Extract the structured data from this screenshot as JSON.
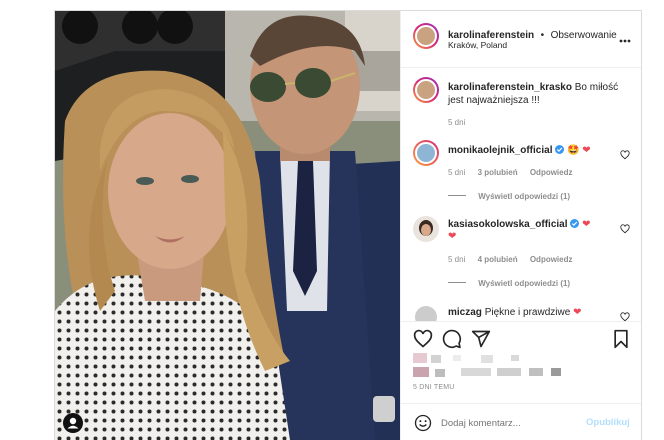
{
  "header": {
    "username": "karolinaferenstein",
    "dot": "•",
    "follow": "Obserwowanie",
    "location": "Kraków, Poland"
  },
  "caption": {
    "username": "karolinaferenstein_krasko",
    "text": "Bo miłość jest najważniejsza !!!",
    "time": "5 dni"
  },
  "comments": [
    {
      "username": "monikaolejnik_official",
      "emoji": "🤩",
      "time": "5 dni",
      "likes": "3 polubień",
      "reply": "Odpowiedz",
      "view_replies": "Wyświetl odpowiedzi (1)"
    },
    {
      "username": "kasiasokolowska_official",
      "time": "5 dni",
      "likes": "4 polubień",
      "reply": "Odpowiedz",
      "view_replies": "Wyświetl odpowiedzi (1)"
    },
    {
      "username": "miczag",
      "text": "Piękne i prawdziwe"
    }
  ],
  "footer": {
    "date": "5 DNI TEMU",
    "comment_placeholder": "Dodaj komentarz...",
    "publish": "Opublikuj"
  },
  "colors": {
    "accent": "#0095f6",
    "publish_disabled": "#b2dffc",
    "heart": "#ed4956",
    "verified": "#3897f0"
  }
}
